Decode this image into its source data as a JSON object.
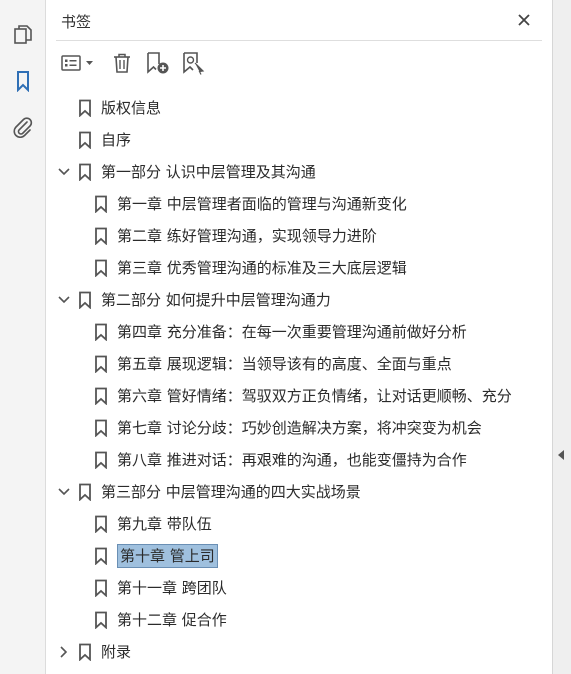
{
  "panel": {
    "title": "书签"
  },
  "left_rail": {
    "icons": [
      "pages-icon",
      "bookmark-icon",
      "attachment-icon"
    ]
  },
  "toolbar": {
    "buttons": [
      "options-menu-icon",
      "delete-icon",
      "new-bookmark-icon",
      "bookmark-from-selection-icon"
    ]
  },
  "colors": {
    "accent": "#2f6fb5",
    "selection": "#9fc0de",
    "icon": "#555555"
  },
  "bookmarks": [
    {
      "label": "版权信息",
      "level": 0,
      "expander": "none"
    },
    {
      "label": "自序",
      "level": 0,
      "expander": "none"
    },
    {
      "label": "第一部分 认识中层管理及其沟通",
      "level": 0,
      "expander": "expanded"
    },
    {
      "label": "第一章 中层管理者面临的管理与沟通新变化",
      "level": 1,
      "expander": "none"
    },
    {
      "label": "第二章 练好管理沟通，实现领导力进阶",
      "level": 1,
      "expander": "none"
    },
    {
      "label": "第三章 优秀管理沟通的标准及三大底层逻辑",
      "level": 1,
      "expander": "none"
    },
    {
      "label": "第二部分 如何提升中层管理沟通力",
      "level": 0,
      "expander": "expanded"
    },
    {
      "label": "第四章 充分准备：在每一次重要管理沟通前做好分析",
      "level": 1,
      "expander": "none"
    },
    {
      "label": "第五章 展现逻辑：当领导该有的高度、全面与重点",
      "level": 1,
      "expander": "none"
    },
    {
      "label": "第六章 管好情绪：驾驭双方正负情绪，让对话更顺畅、充分",
      "level": 1,
      "expander": "none"
    },
    {
      "label": "第七章 讨论分歧：巧妙创造解决方案，将冲突变为机会",
      "level": 1,
      "expander": "none"
    },
    {
      "label": "第八章 推进对话：再艰难的沟通，也能变僵持为合作",
      "level": 1,
      "expander": "none"
    },
    {
      "label": "第三部分 中层管理沟通的四大实战场景",
      "level": 0,
      "expander": "expanded"
    },
    {
      "label": "第九章 带队伍",
      "level": 1,
      "expander": "none"
    },
    {
      "label": "第十章 管上司",
      "level": 1,
      "expander": "none",
      "selected": true
    },
    {
      "label": "第十一章 跨团队",
      "level": 1,
      "expander": "none"
    },
    {
      "label": "第十二章 促合作",
      "level": 1,
      "expander": "none"
    },
    {
      "label": "附录",
      "level": 0,
      "expander": "collapsed"
    }
  ]
}
